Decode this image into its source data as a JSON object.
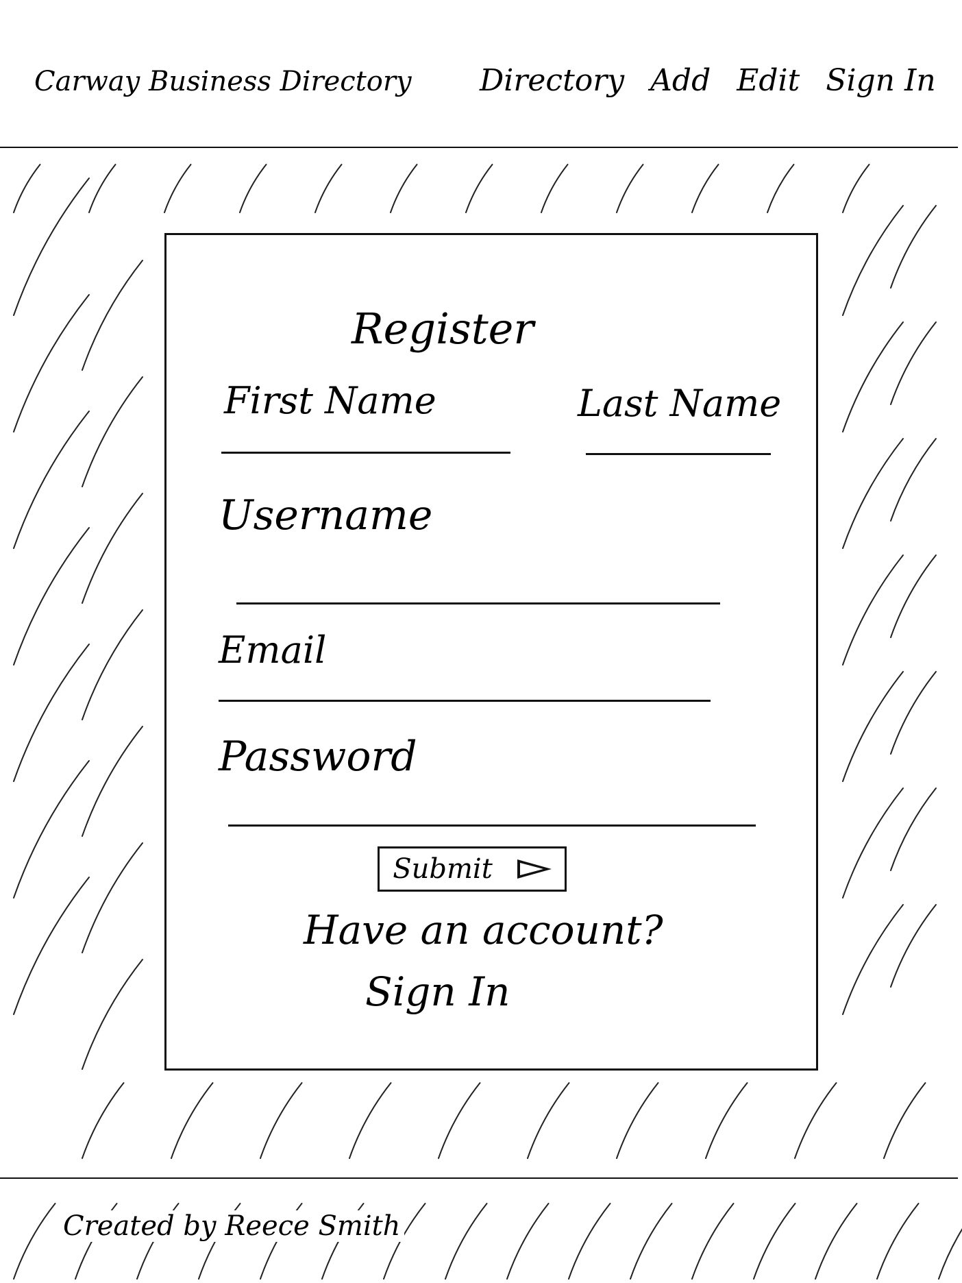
{
  "header": {
    "app_title": "Carway Business Directory",
    "nav": [
      "Directory",
      "Add",
      "Edit",
      "Sign In"
    ]
  },
  "form": {
    "title": "Register",
    "first_name_label": "First Name",
    "last_name_label": "Last Name",
    "username_label": "Username",
    "email_label": "Email",
    "password_label": "Password",
    "submit_label": "Submit",
    "have_account_text": "Have an account?",
    "sign_in_link": "Sign In"
  },
  "footer": {
    "credit": "Created by Reece Smith"
  }
}
